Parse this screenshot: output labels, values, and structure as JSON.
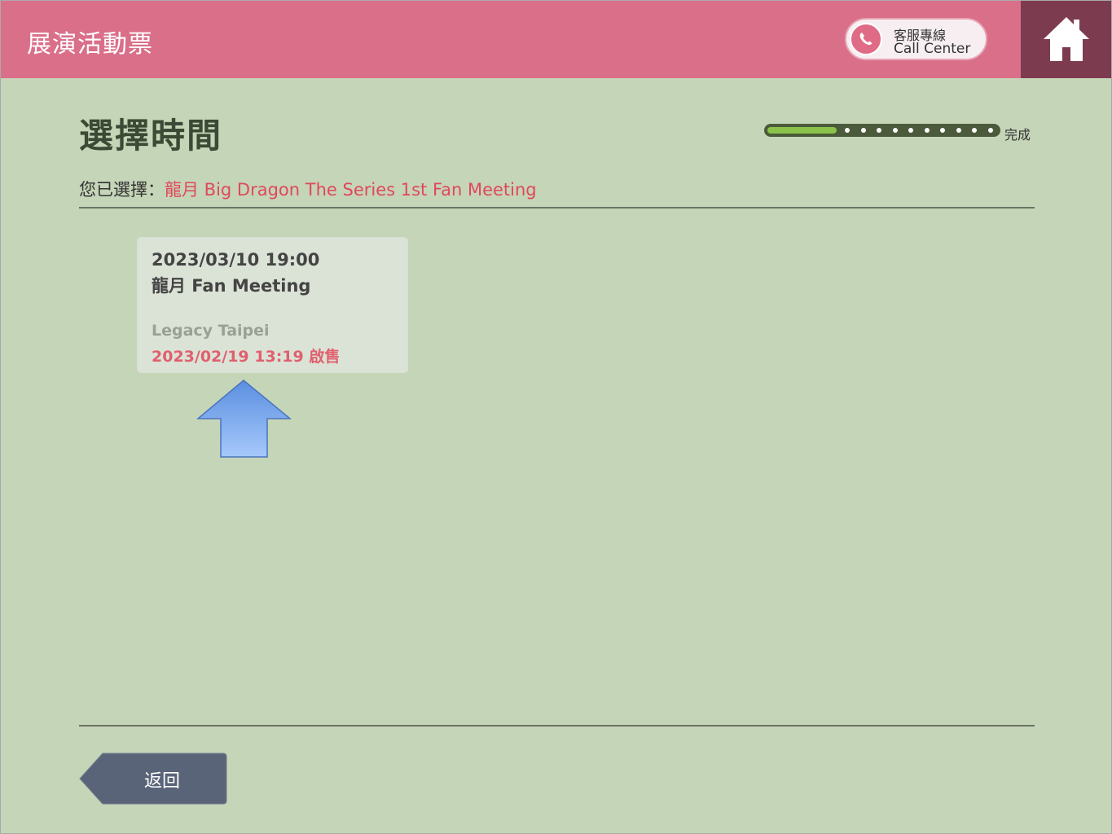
{
  "header": {
    "app_title": "展演活動票",
    "call_center_zh": "客服專線",
    "call_center_en": "Call Center",
    "home_icon": "home-icon",
    "phone_icon": "phone-icon"
  },
  "page": {
    "title": "選擇時間",
    "progress_label": "完成",
    "progress_fraction": 0.3,
    "selection_prefix": "您已選擇：",
    "selected_event": "龍月 Big Dragon The Series 1st Fan Meeting"
  },
  "sessions": [
    {
      "datetime": "2023/03/10 19:00",
      "name": "龍月 Fan Meeting",
      "venue": "Legacy Taipei",
      "sale": "2023/02/19 13:19 啟售"
    }
  ],
  "footer": {
    "back_label": "返回"
  },
  "colors": {
    "header": "#da6f89",
    "home": "#7d3b50",
    "background": "#c5d5b7",
    "accent_red": "#e0485c",
    "progress_green": "#8bc34a"
  }
}
